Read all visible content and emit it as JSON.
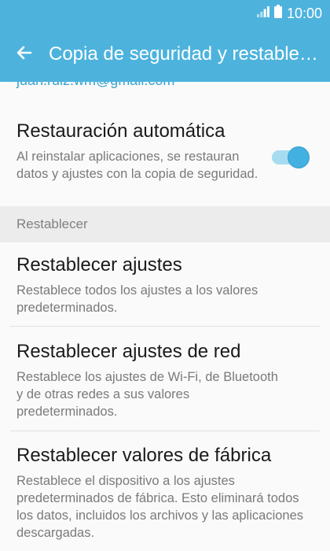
{
  "status_bar": {
    "time": "10:00",
    "signal_icon": "signal-icon",
    "battery_icon": "battery-icon"
  },
  "app_bar": {
    "title": "Copia de seguridad y restablecer",
    "back_icon": "back-arrow-icon",
    "color": "#4db3dd"
  },
  "account": {
    "email": "juan.ruiz.wm@gmail.com"
  },
  "auto_restore": {
    "title": "Restauración automática",
    "description": "Al reinstalar aplicaciones, se restauran datos y ajustes con la copia de seguridad.",
    "enabled": true
  },
  "section": {
    "header": "Restablecer"
  },
  "reset_items": [
    {
      "title": "Restablecer ajustes",
      "description": "Restablece todos los ajustes a los valores predeterminados."
    },
    {
      "title": "Restablecer ajustes de red",
      "description": "Restablece los ajustes de Wi-Fi, de Bluetooth y de otras redes a sus valores predeterminados."
    },
    {
      "title": "Restablecer valores de fábrica",
      "description": "Restablece el dispositivo a los ajustes predeterminados de fábrica. Esto eliminará todos los datos, incluidos los archivos y las aplicaciones descargadas."
    }
  ]
}
